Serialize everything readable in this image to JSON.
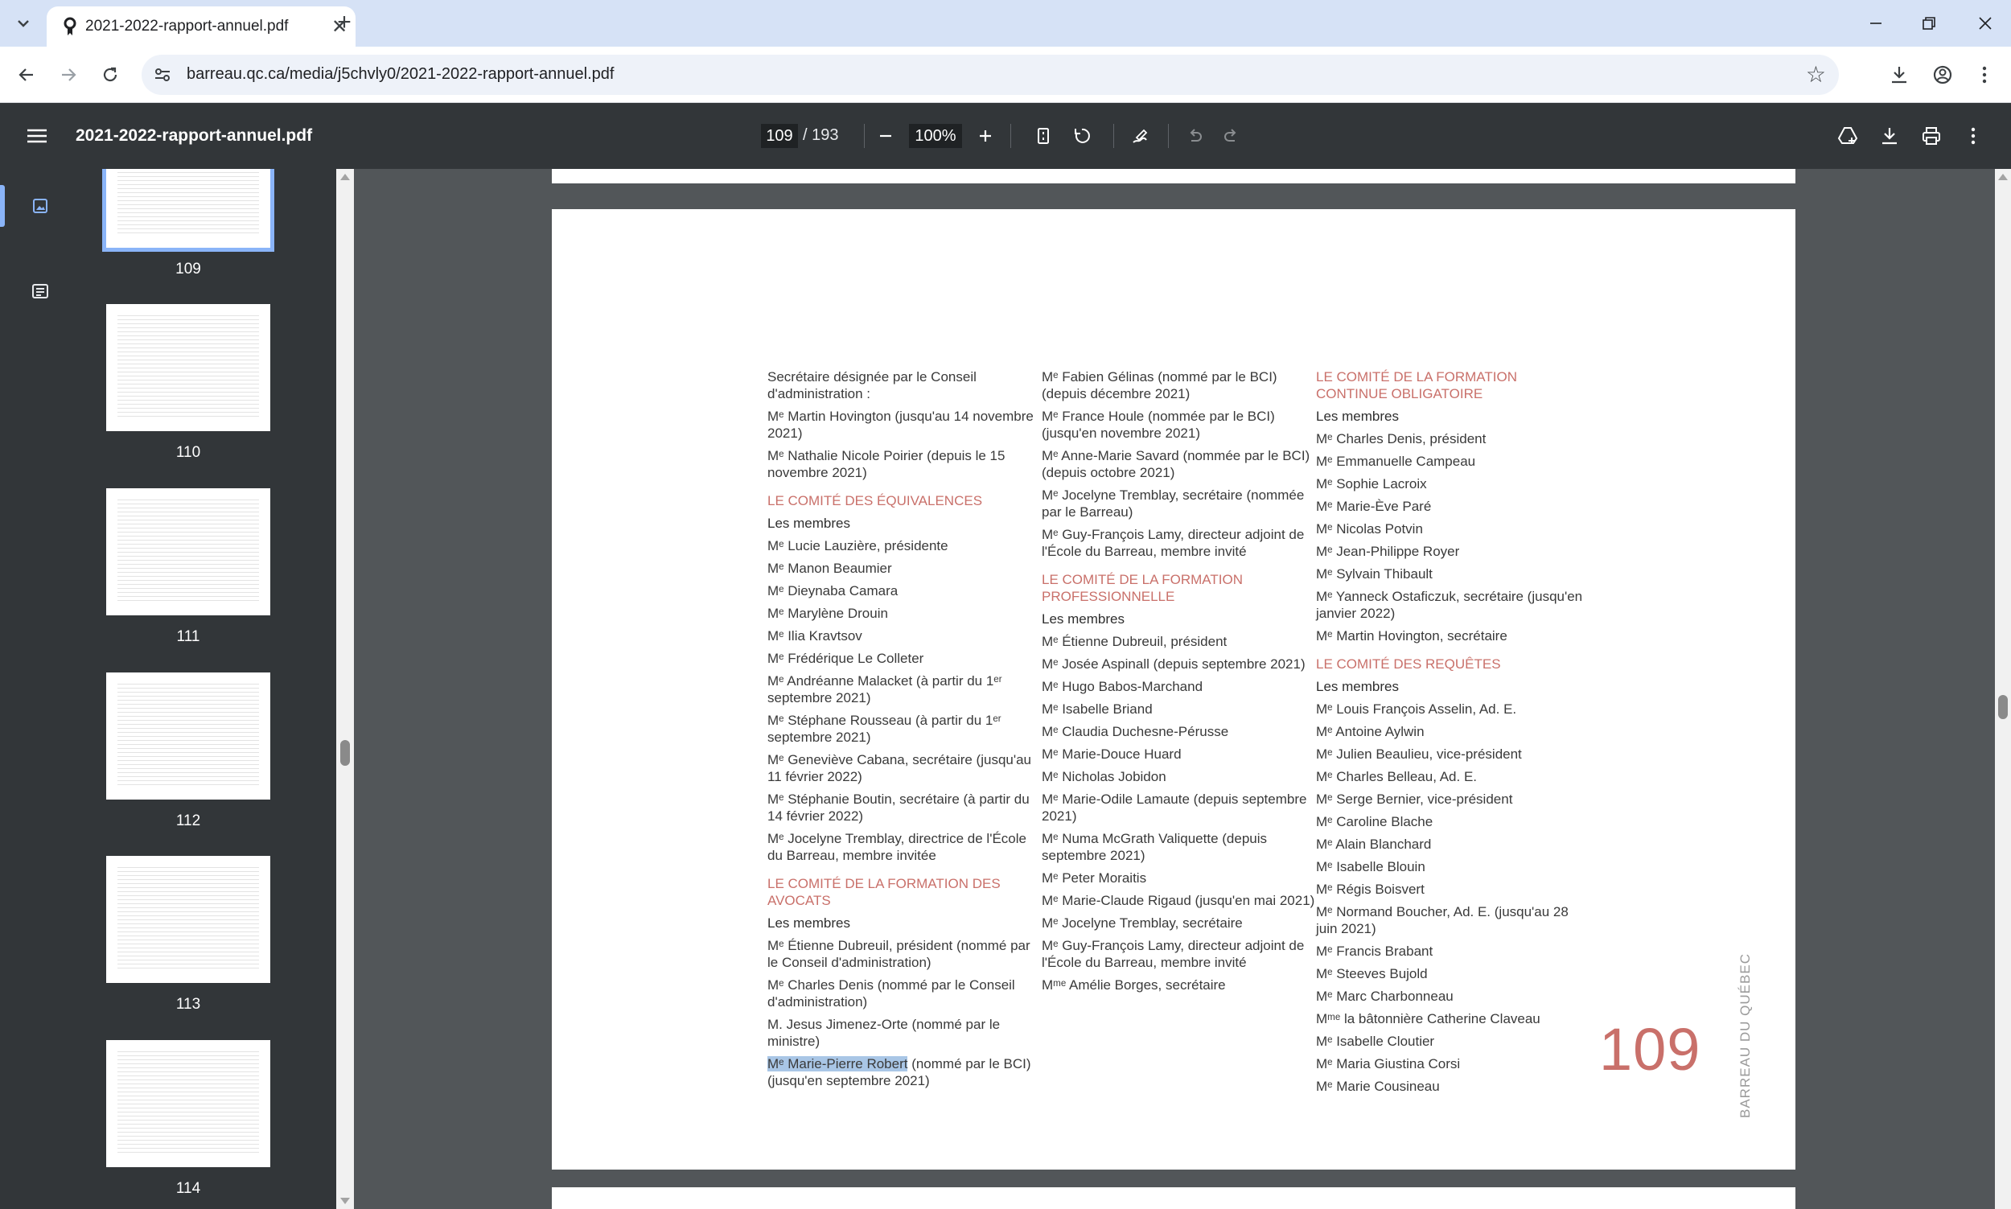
{
  "browser": {
    "tab_title": "2021-2022-rapport-annuel.pdf",
    "tab_close": "✕",
    "new_tab": "+",
    "url": "barreau.qc.ca/media/j5chvly0/2021-2022-rapport-annuel.pdf"
  },
  "pdf_toolbar": {
    "filename": "2021-2022-rapport-annuel.pdf",
    "current_page": "109",
    "total_pages": "/ 193",
    "zoom": "100%"
  },
  "thumbnails": [
    {
      "label": "109",
      "selected": true
    },
    {
      "label": "110"
    },
    {
      "label": "111"
    },
    {
      "label": "112"
    },
    {
      "label": "113"
    },
    {
      "label": "114"
    }
  ],
  "page": {
    "col1": [
      "Secrétaire désignée par le Conseil d'administration :",
      "Mᵉ Martin Hovington (jusqu'au 14 novembre 2021)",
      "Mᵉ Nathalie Nicole Poirier (depuis le 15 novembre 2021)",
      "LE COMITÉ DES ÉQUIVALENCES",
      "Les membres",
      "Mᵉ Lucie Lauzière, présidente",
      "Mᵉ Manon Beaumier",
      "Mᵉ Dieynaba Camara",
      "Mᵉ Marylène Drouin",
      "Mᵉ Ilia Kravtsov",
      "Mᵉ Frédérique Le Colleter",
      "Mᵉ Andréanne Malacket (à partir du 1ᵉʳ septembre 2021)",
      "Mᵉ Stéphane Rousseau (à partir du 1ᵉʳ septembre 2021)",
      "Mᵉ Geneviève Cabana, secrétaire (jusqu'au 11 février 2022)",
      "Mᵉ Stéphanie Boutin, secrétaire (à partir du 14 février 2022)",
      "Mᵉ Jocelyne Tremblay, directrice de l'École du Barreau, membre invitée",
      "LE COMITÉ DE LA FORMATION DES AVOCATS",
      "Les membres",
      "Mᵉ Étienne Dubreuil, président (nommé par le Conseil d'administration)",
      "Mᵉ Charles Denis (nommé par le Conseil d'administration)",
      "M. Jesus Jimenez-Orte (nommé par le ministre)",
      "Mᵉ Marie-Pierre Robert",
      " (nommé par le BCI) (jusqu'en septembre 2021)"
    ],
    "col2": [
      "Mᵉ Fabien Gélinas (nommé par le BCI) (depuis décembre 2021)",
      "Mᵉ France Houle (nommée par le BCI) (jusqu'en novembre 2021)",
      "Mᵉ Anne-Marie Savard (nommée par le BCI) (depuis octobre 2021)",
      "Mᵉ Jocelyne Tremblay, secrétaire (nommée par le Barreau)",
      "Mᵉ Guy-François Lamy, directeur adjoint de l'École du Barreau, membre invité",
      "LE COMITÉ DE LA FORMATION PROFESSIONNELLE",
      "Les membres",
      "Mᵉ Étienne Dubreuil, président",
      "Mᵉ Josée Aspinall (depuis septembre 2021)",
      "Mᵉ Hugo Babos-Marchand",
      "Mᵉ Isabelle Briand",
      "Mᵉ Claudia Duchesne-Pérusse",
      "Mᵉ Marie-Douce Huard",
      "Mᵉ Nicholas Jobidon",
      "Mᵉ Marie-Odile Lamaute (depuis septembre 2021)",
      "Mᵉ Numa McGrath Valiquette (depuis septembre 2021)",
      "Mᵉ Peter Moraitis",
      "Mᵉ Marie-Claude Rigaud (jusqu'en mai 2021)",
      "Mᵉ Jocelyne Tremblay, secrétaire",
      "Mᵉ Guy-François Lamy, directeur adjoint de l'École du Barreau, membre invité",
      "Mᵐᵉ Amélie Borges, secrétaire"
    ],
    "col3": [
      "LE COMITÉ DE LA FORMATION CONTINUE OBLIGATOIRE",
      "Les membres",
      "Mᵉ Charles Denis, président",
      "Mᵉ Emmanuelle Campeau",
      "Mᵉ Sophie Lacroix",
      "Mᵉ Marie-Ève Paré",
      "Mᵉ Nicolas Potvin",
      "Mᵉ Jean-Philippe Royer",
      "Mᵉ Sylvain Thibault",
      "Mᵉ Yanneck Ostaficzuk, secrétaire (jusqu'en janvier 2022)",
      "Mᵉ Martin Hovington, secrétaire",
      "LE COMITÉ DES REQUÊTES",
      "Les membres",
      "Mᵉ Louis François Asselin, Ad. E.",
      "Mᵉ Antoine Aylwin",
      "Mᵉ Julien Beaulieu, vice-président",
      "Mᵉ Charles Belleau, Ad. E.",
      "Mᵉ Serge Bernier, vice-président",
      "Mᵉ Caroline Blache",
      "Mᵉ Alain Blanchard",
      "Mᵉ Isabelle Blouin",
      "Mᵉ Régis Boisvert",
      "Mᵉ Normand Boucher, Ad. E. (jusqu'au 28 juin 2021)",
      "Mᵉ Francis Brabant",
      "Mᵉ Steeves Bujold",
      "Mᵉ Marc Charbonneau",
      "Mᵐᵉ la bâtonnière Catherine Claveau",
      "Mᵉ Isabelle Cloutier",
      "Mᵉ Maria Giustina Corsi",
      "Mᵉ Marie Cousineau"
    ],
    "page_number": "109",
    "side_text": "BARREAU DU QUÉBEC"
  }
}
